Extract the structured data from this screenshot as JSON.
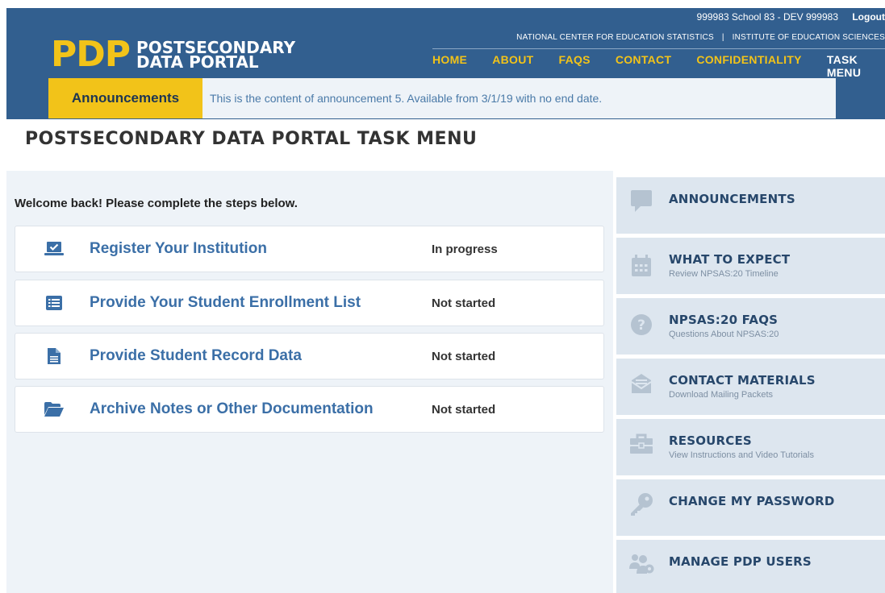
{
  "header": {
    "logo_mark": "PDP",
    "logo_line1": "POSTSECONDARY",
    "logo_line2": "DATA PORTAL",
    "user": "999983 School 83 - DEV 999983",
    "logout": "Logout",
    "agency1": "NATIONAL CENTER FOR EDUCATION STATISTICS",
    "separator": "|",
    "agency2": "INSTITUTE OF EDUCATION SCIENCES",
    "nav": [
      "HOME",
      "ABOUT",
      "FAQS",
      "CONTACT",
      "CONFIDENTIALITY",
      "TASK MENU"
    ]
  },
  "announcement": {
    "label": "Announcements",
    "text": "This is the content of announcement 5. Available from 3/1/19 with no end date."
  },
  "page_title": "POSTSECONDARY DATA PORTAL TASK MENU",
  "main": {
    "welcome": "Welcome back! Please complete the steps below.",
    "tasks": [
      {
        "label": "Register Your Institution",
        "status": "In progress",
        "icon": "laptop-check-icon"
      },
      {
        "label": "Provide Your Student Enrollment List",
        "status": "Not started",
        "icon": "list-icon"
      },
      {
        "label": "Provide Student Record Data",
        "status": "Not started",
        "icon": "document-icon"
      },
      {
        "label": "Archive Notes or Other Documentation",
        "status": "Not started",
        "icon": "folder-open-icon"
      }
    ]
  },
  "sidebar": {
    "items": [
      {
        "title": "ANNOUNCEMENTS",
        "subtitle": "",
        "icon": "comment-icon"
      },
      {
        "title": "WHAT TO EXPECT",
        "subtitle": "Review NPSAS:20 Timeline",
        "icon": "calendar-icon"
      },
      {
        "title": "NPSAS:20 FAQS",
        "subtitle": "Questions About NPSAS:20",
        "icon": "question-circle-icon"
      },
      {
        "title": "CONTACT MATERIALS",
        "subtitle": "Download Mailing Packets",
        "icon": "envelope-open-icon"
      },
      {
        "title": "RESOURCES",
        "subtitle": "View Instructions and Video Tutorials",
        "icon": "toolbox-icon"
      },
      {
        "title": "CHANGE MY PASSWORD",
        "subtitle": "",
        "icon": "key-icon"
      },
      {
        "title": "MANAGE PDP USERS",
        "subtitle": "",
        "icon": "users-cog-icon"
      }
    ]
  },
  "colors": {
    "header_bg": "#325f8f",
    "accent_yellow": "#f2c319",
    "link_blue": "#3b6fa7",
    "panel_bg": "#eef3f8",
    "sidebar_bg": "#dde6ef",
    "sidebar_title": "#27476b",
    "icon_grey": "#b5c3d1"
  }
}
